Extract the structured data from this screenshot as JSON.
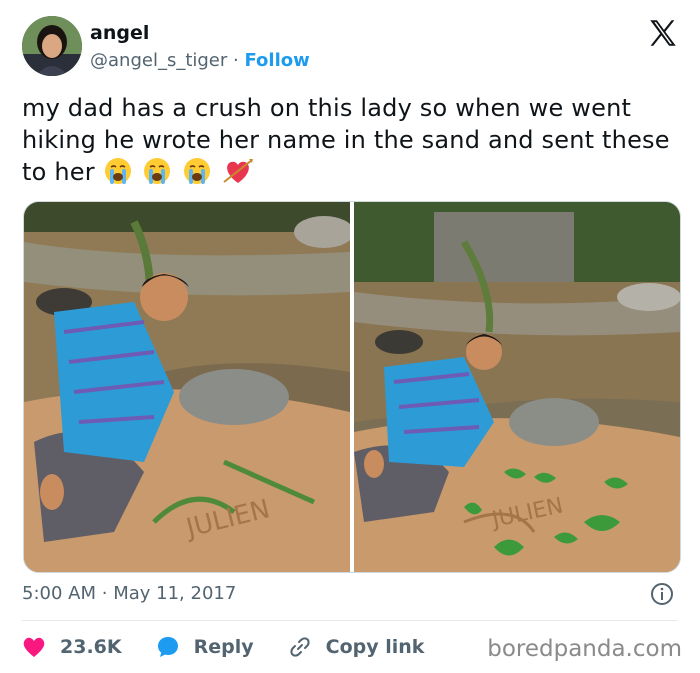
{
  "author": {
    "display_name": "angel",
    "handle": "@angel_s_tiger",
    "separator": "·",
    "follow_label": "Follow"
  },
  "tweet": {
    "text": "my dad has a crush on this lady so when we went hiking he wrote her name in the sand and sent these to her",
    "emojis": [
      "loudly-crying-face",
      "loudly-crying-face",
      "loudly-crying-face",
      "heart-with-arrow"
    ]
  },
  "media": {
    "photos": [
      {
        "sand_text": "JULIEN"
      },
      {
        "sand_text": "JULIEN"
      }
    ]
  },
  "meta": {
    "time": "5:00 AM",
    "separator": "·",
    "date": "May 11, 2017"
  },
  "actions": {
    "likes": "23.6K",
    "reply_label": "Reply",
    "copy_link_label": "Copy link"
  },
  "watermark": "boredpanda.com",
  "colors": {
    "accent": "#1d9bf0",
    "like": "#f91880",
    "secondary_text": "#536471"
  }
}
